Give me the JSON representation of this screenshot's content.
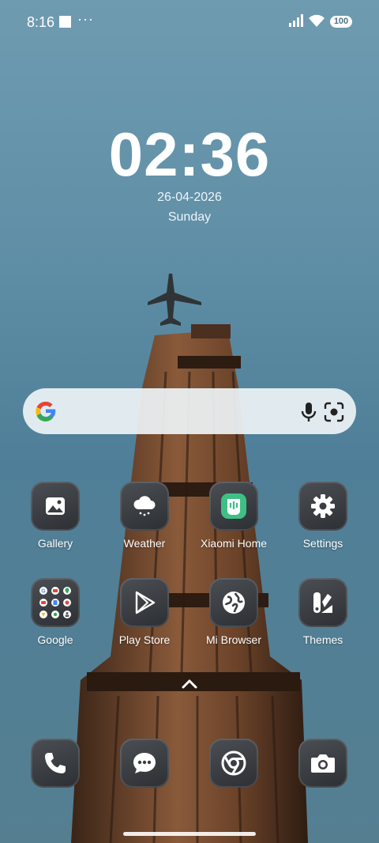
{
  "status_bar": {
    "time": "8:16",
    "overflow": "···",
    "battery": "100"
  },
  "clock": {
    "time": "02:36",
    "date": "26-04-2026",
    "day": "Sunday"
  },
  "search": {
    "logo": "google-g-icon",
    "mic": "mic-icon",
    "lens": "google-lens-icon"
  },
  "apps": [
    {
      "label": "Gallery",
      "icon": "gallery-icon"
    },
    {
      "label": "Weather",
      "icon": "weather-icon"
    },
    {
      "label": "Xiaomi Home",
      "icon": "xiaomi-home-icon"
    },
    {
      "label": "Settings",
      "icon": "gear-icon"
    },
    {
      "label": "Google",
      "icon": "google-folder-icon"
    },
    {
      "label": "Play Store",
      "icon": "play-store-icon"
    },
    {
      "label": "Mi Browser",
      "icon": "globe-icon"
    },
    {
      "label": "Themes",
      "icon": "themes-icon"
    }
  ],
  "dock": [
    {
      "icon": "phone-icon"
    },
    {
      "icon": "messages-icon"
    },
    {
      "icon": "chrome-icon"
    },
    {
      "icon": "camera-icon"
    }
  ],
  "colors": {
    "xiaomi_green": "#3fbf86",
    "icon_bg": "#3a3e43"
  }
}
